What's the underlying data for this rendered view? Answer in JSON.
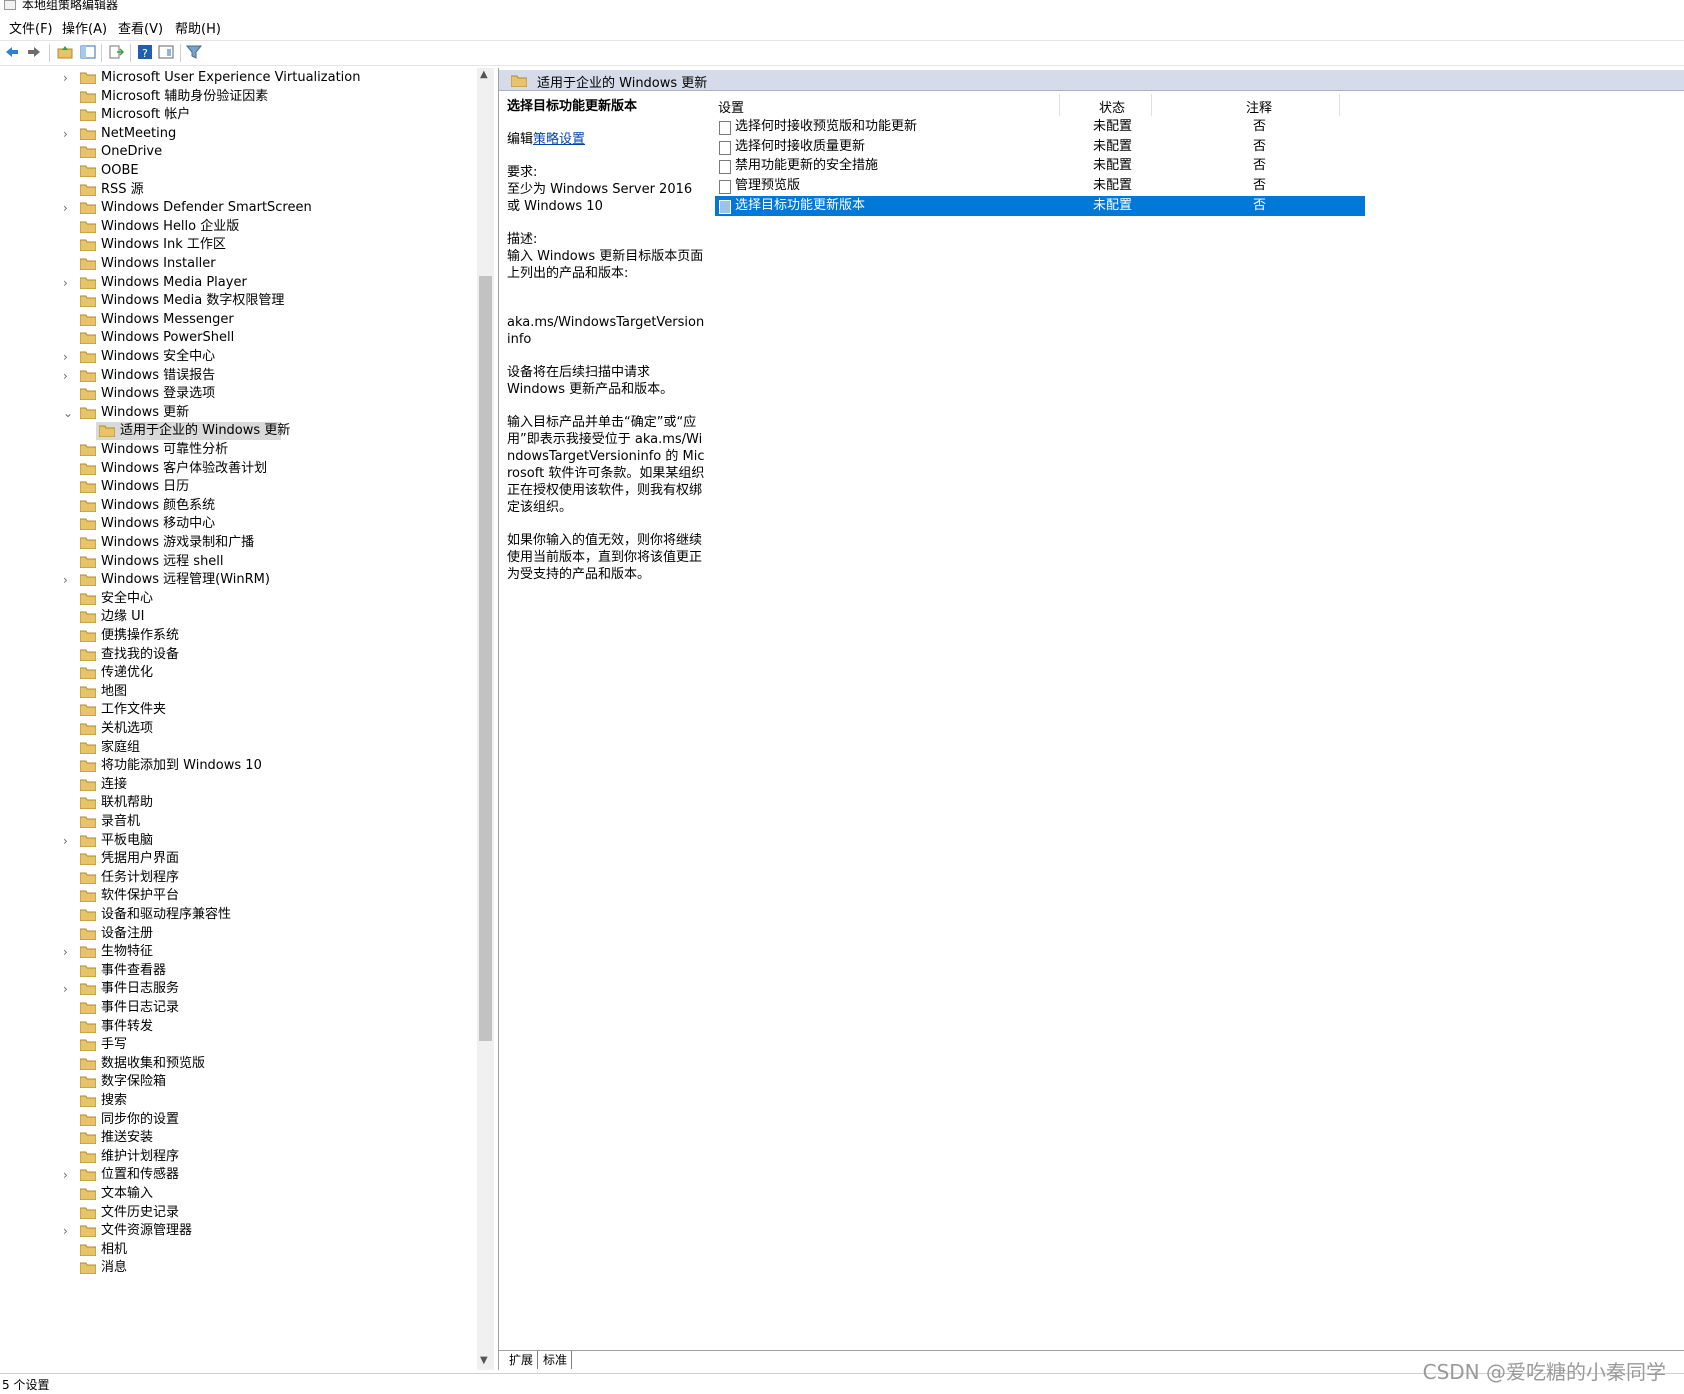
{
  "window": {
    "title": "本地组策略编辑器"
  },
  "menu": [
    "文件(F)",
    "操作(A)",
    "查看(V)",
    "帮助(H)"
  ],
  "toolbar": {
    "icons": [
      "back-arrow-icon",
      "forward-arrow-icon",
      "up-folder-icon",
      "show-hide-tree-icon",
      "export-list-icon",
      "help-icon",
      "properties-icon",
      "filter-icon"
    ]
  },
  "tree": {
    "items": [
      {
        "label": "Microsoft User Experience Virtualization",
        "expandable": true
      },
      {
        "label": "Microsoft 辅助身份验证因素",
        "expandable": false
      },
      {
        "label": "Microsoft 帐户",
        "expandable": false
      },
      {
        "label": "NetMeeting",
        "expandable": true
      },
      {
        "label": "OneDrive",
        "expandable": false
      },
      {
        "label": "OOBE",
        "expandable": false
      },
      {
        "label": "RSS 源",
        "expandable": false
      },
      {
        "label": "Windows Defender SmartScreen",
        "expandable": true
      },
      {
        "label": "Windows Hello 企业版",
        "expandable": false
      },
      {
        "label": "Windows Ink 工作区",
        "expandable": false
      },
      {
        "label": "Windows Installer",
        "expandable": false
      },
      {
        "label": "Windows Media Player",
        "expandable": true
      },
      {
        "label": "Windows Media 数字权限管理",
        "expandable": false
      },
      {
        "label": "Windows Messenger",
        "expandable": false
      },
      {
        "label": "Windows PowerShell",
        "expandable": false
      },
      {
        "label": "Windows 安全中心",
        "expandable": true
      },
      {
        "label": "Windows 错误报告",
        "expandable": true
      },
      {
        "label": "Windows 登录选项",
        "expandable": false
      },
      {
        "label": "Windows 更新",
        "expandable": true,
        "expanded": true
      },
      {
        "label": "适用于企业的 Windows 更新",
        "child": true,
        "selected": true
      },
      {
        "label": "Windows 可靠性分析",
        "expandable": false
      },
      {
        "label": "Windows 客户体验改善计划",
        "expandable": false
      },
      {
        "label": "Windows 日历",
        "expandable": false
      },
      {
        "label": "Windows 颜色系统",
        "expandable": false
      },
      {
        "label": "Windows 移动中心",
        "expandable": false
      },
      {
        "label": "Windows 游戏录制和广播",
        "expandable": false
      },
      {
        "label": "Windows 远程 shell",
        "expandable": false
      },
      {
        "label": "Windows 远程管理(WinRM)",
        "expandable": true
      },
      {
        "label": "安全中心",
        "expandable": false
      },
      {
        "label": "边缘 UI",
        "expandable": false
      },
      {
        "label": "便携操作系统",
        "expandable": false
      },
      {
        "label": "查找我的设备",
        "expandable": false
      },
      {
        "label": "传递优化",
        "expandable": false
      },
      {
        "label": "地图",
        "expandable": false
      },
      {
        "label": "工作文件夹",
        "expandable": false
      },
      {
        "label": "关机选项",
        "expandable": false
      },
      {
        "label": "家庭组",
        "expandable": false
      },
      {
        "label": "将功能添加到 Windows 10",
        "expandable": false
      },
      {
        "label": "连接",
        "expandable": false
      },
      {
        "label": "联机帮助",
        "expandable": false
      },
      {
        "label": "录音机",
        "expandable": false
      },
      {
        "label": "平板电脑",
        "expandable": true
      },
      {
        "label": "凭据用户界面",
        "expandable": false
      },
      {
        "label": "任务计划程序",
        "expandable": false
      },
      {
        "label": "软件保护平台",
        "expandable": false
      },
      {
        "label": "设备和驱动程序兼容性",
        "expandable": false
      },
      {
        "label": "设备注册",
        "expandable": false
      },
      {
        "label": "生物特征",
        "expandable": true
      },
      {
        "label": "事件查看器",
        "expandable": false
      },
      {
        "label": "事件日志服务",
        "expandable": true
      },
      {
        "label": "事件日志记录",
        "expandable": false
      },
      {
        "label": "事件转发",
        "expandable": false
      },
      {
        "label": "手写",
        "expandable": false
      },
      {
        "label": "数据收集和预览版",
        "expandable": false
      },
      {
        "label": "数字保险箱",
        "expandable": false
      },
      {
        "label": "搜索",
        "expandable": false
      },
      {
        "label": "同步你的设置",
        "expandable": false
      },
      {
        "label": "推送安装",
        "expandable": false
      },
      {
        "label": "维护计划程序",
        "expandable": false
      },
      {
        "label": "位置和传感器",
        "expandable": true
      },
      {
        "label": "文本输入",
        "expandable": false
      },
      {
        "label": "文件历史记录",
        "expandable": false
      },
      {
        "label": "文件资源管理器",
        "expandable": true
      },
      {
        "label": "相机",
        "expandable": false
      },
      {
        "label": "消息",
        "expandable": false
      }
    ]
  },
  "right": {
    "header": "适用于企业的 Windows 更新",
    "desc": {
      "title": "选择目标功能更新版本",
      "edit_prefix": "编辑",
      "edit_link": "策略设置",
      "req_label": "要求:",
      "req_text": "至少为 Windows Server 2016 或 Windows 10",
      "desc_label": "描述:",
      "desc_p1": "输入 Windows 更新目标版本页面上列出的产品和版本:",
      "desc_url": "aka.ms/WindowsTargetVersioninfo",
      "desc_p2": "设备将在后续扫描中请求 Windows 更新产品和版本。",
      "desc_p3": "输入目标产品并单击“确定”或“应用”即表示我接受位于 aka.ms/WindowsTargetVersioninfo 的 Microsoft 软件许可条款。如果某组织正在授权使用该软件，则我有权绑定该组织。",
      "desc_p4": "如果你输入的值无效，则你将继续使用当前版本，直到你将该值更正为受支持的产品和版本。"
    },
    "columns": [
      "设置",
      "状态",
      "注释"
    ],
    "rows": [
      {
        "name": "选择何时接收预览版和功能更新",
        "state": "未配置",
        "note": "否"
      },
      {
        "name": "选择何时接收质量更新",
        "state": "未配置",
        "note": "否"
      },
      {
        "name": "禁用功能更新的安全措施",
        "state": "未配置",
        "note": "否"
      },
      {
        "name": "管理预览版",
        "state": "未配置",
        "note": "否"
      },
      {
        "name": "选择目标功能更新版本",
        "state": "未配置",
        "note": "否",
        "selected": true
      }
    ],
    "tabs": [
      "扩展",
      "标准"
    ]
  },
  "status": {
    "text": "5 个设置"
  },
  "watermark": "CSDN @爱吃糖的小秦同学",
  "colors": {
    "selection": "#0078d7",
    "header_bg": "#d6dbe9",
    "folder": "#e8c468"
  }
}
